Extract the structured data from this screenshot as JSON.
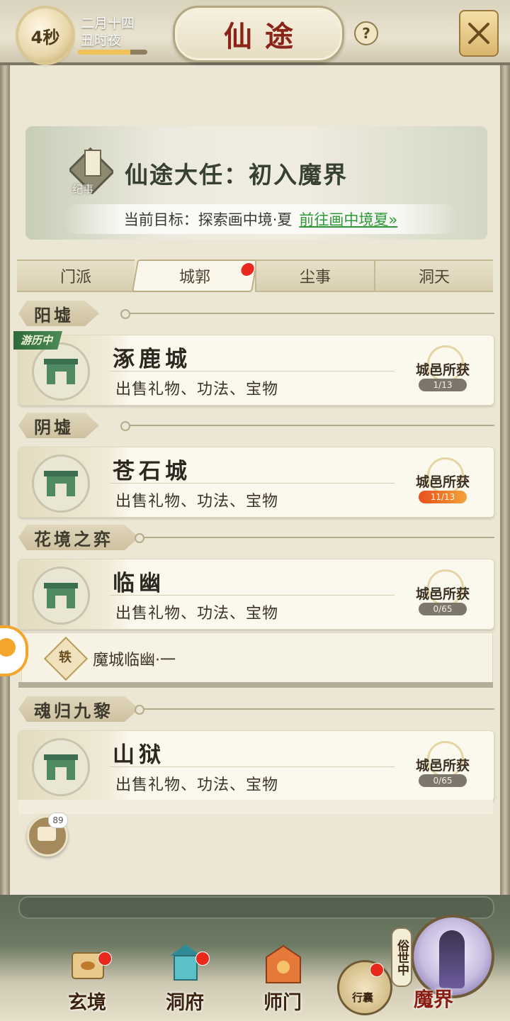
{
  "header": {
    "timer": "4秒",
    "date_line1": "二月十四",
    "date_line2": "丑时夜",
    "day_progress": 0.75,
    "title": "仙途",
    "help": "?"
  },
  "quest": {
    "icon_label": "纪事",
    "title": "仙途大任：初入魔界",
    "goal_text": "当前目标：探索画中境·夏",
    "goal_link": "前往画中境夏»"
  },
  "tabs": [
    {
      "label": "门派",
      "active": false
    },
    {
      "label": "城郭",
      "active": true,
      "has_dot": true
    },
    {
      "label": "尘事",
      "active": false
    },
    {
      "label": "洞天",
      "active": false
    }
  ],
  "sections": [
    {
      "label": "阳墟",
      "cities": [
        {
          "name": "涿鹿城",
          "desc": "出售礼物、功法、宝物",
          "reward_label": "城邑所获",
          "reward_count": "1/13",
          "tag": "游历中"
        }
      ]
    },
    {
      "label": "阴墟",
      "cities": [
        {
          "name": "苍石城",
          "desc": "出售礼物、功法、宝物",
          "reward_label": "城邑所获",
          "reward_count": "11/13"
        }
      ]
    },
    {
      "label": "花境之弈",
      "cities": [
        {
          "name": "临幽",
          "desc": "出售礼物、功法、宝物",
          "reward_label": "城邑所获",
          "reward_count": "0/65"
        }
      ],
      "sub_item": {
        "icon_char": "轶",
        "label": "魔城临幽·一"
      }
    },
    {
      "label": "魂归九黎",
      "cities": [
        {
          "name": "山狱",
          "desc": "出售礼物、功法、宝物",
          "reward_label": "城邑所获",
          "reward_count": "0/65"
        }
      ]
    }
  ],
  "chat": {
    "badge": "89"
  },
  "bottom_nav": [
    {
      "label": "玄境",
      "has_dot": true
    },
    {
      "label": "洞府",
      "has_dot": true
    },
    {
      "label": "师门",
      "has_dot": false
    }
  ],
  "bag": {
    "label": "行囊",
    "has_dot": true
  },
  "realm": {
    "vertical_label": "俗世中",
    "label": "魔界"
  },
  "colors": {
    "accent_red": "#8a2418",
    "link_green": "#2f9a3a",
    "dot_red": "#e8291b"
  }
}
